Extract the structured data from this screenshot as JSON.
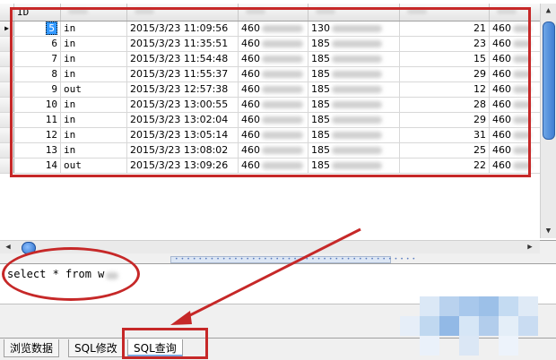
{
  "grid": {
    "columns": [
      "ID",
      "",
      "",
      "",
      "",
      "",
      ""
    ],
    "rows": [
      {
        "id": "5",
        "type": "in",
        "time": "2015/3/23 11:09:56",
        "imsi": "460",
        "phone": "130",
        "num": "21",
        "last": "460"
      },
      {
        "id": "6",
        "type": "in",
        "time": "2015/3/23 11:35:51",
        "imsi": "460",
        "phone": "185",
        "num": "23",
        "last": "460"
      },
      {
        "id": "7",
        "type": "in",
        "time": "2015/3/23 11:54:48",
        "imsi": "460",
        "phone": "185",
        "num": "15",
        "last": "460"
      },
      {
        "id": "8",
        "type": "in",
        "time": "2015/3/23 11:55:37",
        "imsi": "460",
        "phone": "185",
        "num": "29",
        "last": "460"
      },
      {
        "id": "9",
        "type": "out",
        "time": "2015/3/23 12:57:38",
        "imsi": "460",
        "phone": "185",
        "num": "12",
        "last": "460"
      },
      {
        "id": "10",
        "type": "in",
        "time": "2015/3/23 13:00:55",
        "imsi": "460",
        "phone": "185",
        "num": "28",
        "last": "460"
      },
      {
        "id": "11",
        "type": "in",
        "time": "2015/3/23 13:02:04",
        "imsi": "460",
        "phone": "185",
        "num": "29",
        "last": "460"
      },
      {
        "id": "12",
        "type": "in",
        "time": "2015/3/23 13:05:14",
        "imsi": "460",
        "phone": "185",
        "num": "31",
        "last": "460"
      },
      {
        "id": "13",
        "type": "in",
        "time": "2015/3/23 13:08:02",
        "imsi": "460",
        "phone": "185",
        "num": "25",
        "last": "460"
      },
      {
        "id": "14",
        "type": "out",
        "time": "2015/3/23 13:09:26",
        "imsi": "460",
        "phone": "185",
        "num": "22",
        "last": "460"
      }
    ],
    "current_row_marker": "▶"
  },
  "scrollbars": {
    "up": "▲",
    "down": "▼",
    "left": "◀",
    "right": "▶"
  },
  "sql": {
    "query": "select * from w"
  },
  "tabs": [
    {
      "label": "浏览数据",
      "active": false
    },
    {
      "label": "SQL修改",
      "active": false
    },
    {
      "label": "SQL查询",
      "active": true
    }
  ],
  "colors": {
    "annotation": "#c62828",
    "selection": "#3399ff"
  }
}
